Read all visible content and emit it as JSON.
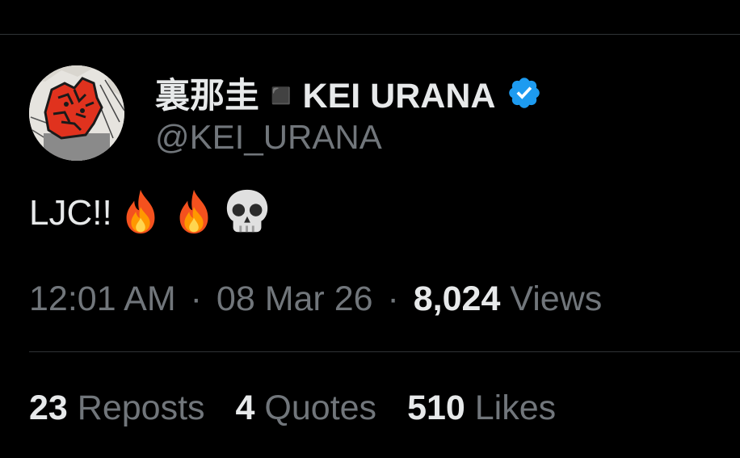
{
  "author": {
    "display_name": "裏那圭◾️KEI URANA",
    "handle": "@KEI_URANA",
    "verified": true,
    "avatar_icon": "manga-red-hand-avatar"
  },
  "tweet": {
    "text": "LJC!!",
    "emojis": [
      "fire-emoji",
      "fire-emoji",
      "skull-emoji"
    ]
  },
  "meta": {
    "time": "12:01 AM",
    "separator": "·",
    "date": "08 Mar 26",
    "views_count": "8,024",
    "views_label": "Views"
  },
  "stats": [
    {
      "count": "23",
      "label": "Reposts"
    },
    {
      "count": "4",
      "label": "Quotes"
    },
    {
      "count": "510",
      "label": "Likes"
    }
  ],
  "colors": {
    "background": "#000000",
    "primary_text": "#e7e9ea",
    "secondary_text": "#71767b",
    "divider": "#2f3336",
    "verified_blue": "#1d9bf0"
  }
}
